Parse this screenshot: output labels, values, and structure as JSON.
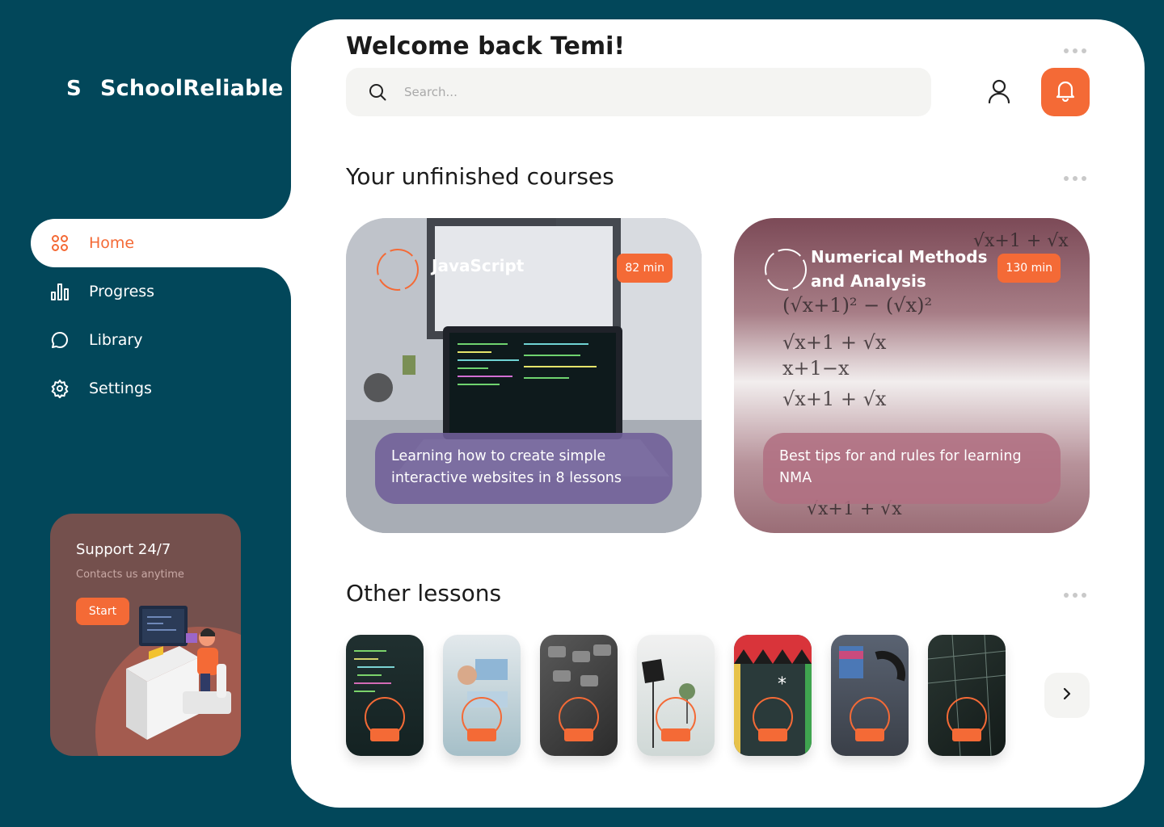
{
  "app": {
    "logo_letter": "S",
    "name": "SchoolReliable"
  },
  "nav": {
    "items": [
      {
        "label": "Home",
        "icon": "grid-icon",
        "active": true
      },
      {
        "label": "Progress",
        "icon": "bar-chart-icon",
        "active": false
      },
      {
        "label": "Library",
        "icon": "chat-bubble-icon",
        "active": false
      },
      {
        "label": "Settings",
        "icon": "gear-icon",
        "active": false
      }
    ]
  },
  "support": {
    "title": "Support 24/7",
    "subtitle": "Contacts us anytime",
    "button_label": "Start"
  },
  "header": {
    "welcome": "Welcome back Temi!"
  },
  "search": {
    "placeholder": "Search..."
  },
  "sections": {
    "unfinished_title": "Your unfinished courses",
    "other_title": "Other lessons"
  },
  "courses": [
    {
      "title": "JavaScript",
      "duration": "82 min",
      "description": "Learning how to create simple interactive websites in 8 lessons"
    },
    {
      "title": "Numerical Methods and Analysis",
      "duration": "130 min",
      "description": "Best tips for and rules for learning NMA"
    }
  ],
  "lessons": [
    {
      "icon": "code-screen-thumbnail"
    },
    {
      "icon": "whiteboard-thumbnail"
    },
    {
      "icon": "typewriter-keys-thumbnail"
    },
    {
      "icon": "photo-studio-thumbnail"
    },
    {
      "icon": "art-mural-thumbnail"
    },
    {
      "icon": "headphones-thumbnail"
    },
    {
      "icon": "circuit-board-thumbnail"
    }
  ],
  "colors": {
    "background": "#02475a",
    "accent": "#f46a36",
    "panel": "#ffffff",
    "support_card": "#74504d"
  }
}
